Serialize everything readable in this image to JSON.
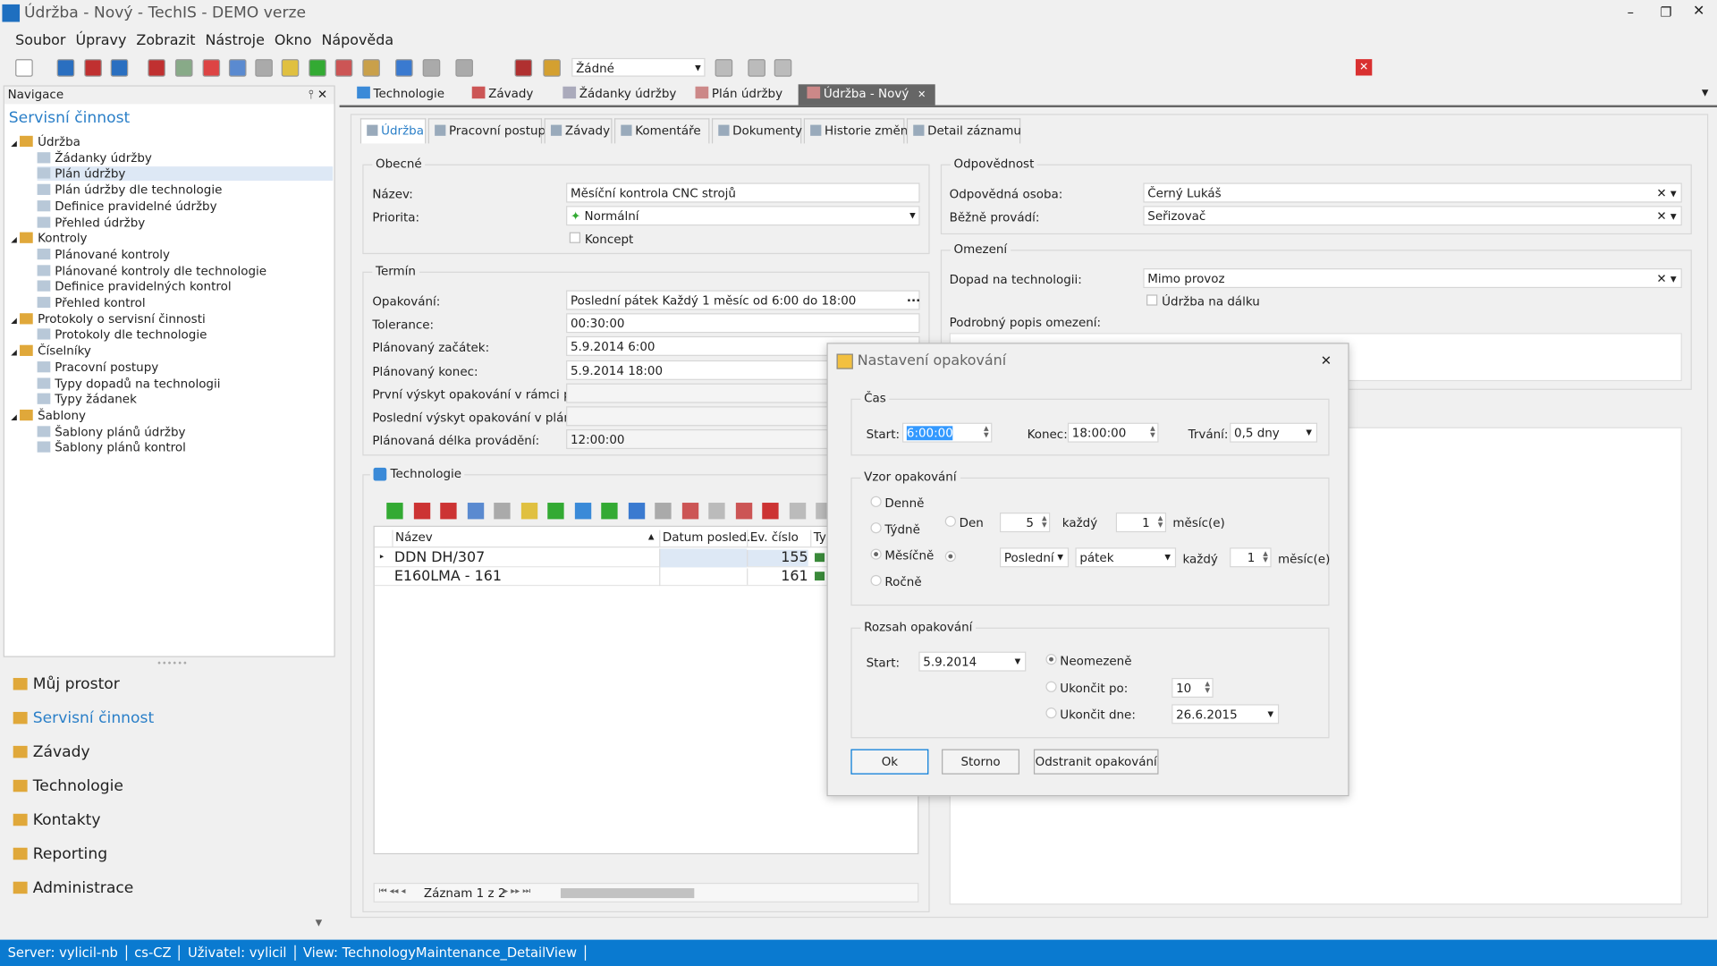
{
  "window": {
    "title": "Údržba - Nový - TechIS - DEMO verze"
  },
  "menu": [
    "Soubor",
    "Úpravy",
    "Zobrazit",
    "Nástroje",
    "Okno",
    "Nápověda"
  ],
  "toolbar": {
    "filter_value": "Žádné"
  },
  "navigation": {
    "title": "Navigace",
    "section": "Servisní činnost",
    "tree": [
      {
        "label": "Údržba",
        "level": 0
      },
      {
        "label": "Žádanky údržby",
        "level": 1
      },
      {
        "label": "Plán údržby",
        "level": 1,
        "selected": true
      },
      {
        "label": "Plán údržby dle technologie",
        "level": 1
      },
      {
        "label": "Definice pravidelné údržby",
        "level": 1
      },
      {
        "label": "Přehled údržby",
        "level": 1
      },
      {
        "label": "Kontroly",
        "level": 0
      },
      {
        "label": "Plánované kontroly",
        "level": 1
      },
      {
        "label": "Plánované kontroly dle technologie",
        "level": 1
      },
      {
        "label": "Definice pravidelných kontrol",
        "level": 1
      },
      {
        "label": "Přehled kontrol",
        "level": 1
      },
      {
        "label": "Protokoly o servisní činnosti",
        "level": 0
      },
      {
        "label": "Protokoly dle technologie",
        "level": 1
      },
      {
        "label": "Číselníky",
        "level": 0
      },
      {
        "label": "Pracovní postupy",
        "level": 1
      },
      {
        "label": "Typy dopadů na technologii",
        "level": 1
      },
      {
        "label": "Typy žádanek",
        "level": 1
      },
      {
        "label": "Šablony",
        "level": 0
      },
      {
        "label": "Šablony plánů údržby",
        "level": 1
      },
      {
        "label": "Šablony plánů kontrol",
        "level": 1
      }
    ],
    "modules": [
      "Můj prostor",
      "Servisní činnost",
      "Závady",
      "Technologie",
      "Kontakty",
      "Reporting",
      "Administrace"
    ]
  },
  "doc_tabs": [
    "Technologie",
    "Závady",
    "Žádanky údržby",
    "Plán údržby",
    "Údržba - Nový"
  ],
  "detail_tabs": [
    "Údržba",
    "Pracovní postup",
    "Závady",
    "Komentáře",
    "Dokumenty",
    "Historie změn",
    "Detail záznamu"
  ],
  "obecne": {
    "title": "Obecné",
    "name_label": "Název:",
    "name": "Měsíční kontrola CNC strojů",
    "priority_label": "Priorita:",
    "priority": "Normální",
    "koncept": "Koncept"
  },
  "termin": {
    "title": "Termín",
    "fields": [
      {
        "label": "Opakování:",
        "value": "Poslední pátek Každý 1 měsíc od 6:00 do 18:00"
      },
      {
        "label": "Tolerance:",
        "value": "00:30:00"
      },
      {
        "label": "Plánovaný začátek:",
        "value": "5.9.2014 6:00"
      },
      {
        "label": "Plánovaný konec:",
        "value": "5.9.2014 18:00"
      },
      {
        "label": "První výskyt opakování v rámci plánu:",
        "value": ""
      },
      {
        "label": "Poslední výskyt opakování v plánu:",
        "value": ""
      },
      {
        "label": "Plánovaná délka provádění:",
        "value": "12:00:00"
      }
    ]
  },
  "technologie": {
    "title": "Technologie",
    "columns": [
      "Název",
      "Datum posled...",
      "Ev. číslo",
      "Typ"
    ],
    "rows": [
      {
        "name": "DDN  DH/307",
        "date": "",
        "ev": "155"
      },
      {
        "name": "E160LMA - 161",
        "date": "",
        "ev": "161"
      }
    ],
    "pager": "Záznam 1 z 2"
  },
  "odpovednost": {
    "title": "Odpovědnost",
    "person_label": "Odpovědná osoba:",
    "person": "Černý Lukáš",
    "performer_label": "Běžně provádí:",
    "performer": "Seřizovač"
  },
  "omezeni": {
    "title": "Omezení",
    "impact_label": "Dopad na technologii:",
    "impact": "Mimo provoz",
    "remote": "Údržba na dálku",
    "desc_label": "Podrobný popis omezení:"
  },
  "dialog": {
    "title": "Nastavení opakování",
    "cas": {
      "title": "Čas",
      "start_label": "Start:",
      "start": "6:00:00",
      "end_label": "Konec:",
      "end": "18:00:00",
      "duration_label": "Trvání:",
      "duration": "0,5 dny"
    },
    "vzor": {
      "title": "Vzor opakování",
      "options": [
        "Denně",
        "Týdně",
        "Měsíčně",
        "Ročně"
      ],
      "selected": "Měsíčně",
      "den_label": "Den",
      "den": "5",
      "kazdy": "každý",
      "every1": "1",
      "mesic": "měsíc(e)",
      "which": "Poslední",
      "weekday": "pátek",
      "every2": "1"
    },
    "rozsah": {
      "title": "Rozsah opakování",
      "start_label": "Start:",
      "start": "5.9.2014",
      "unlimited": "Neomezeně",
      "after_label": "Ukončit po:",
      "after": "10",
      "by_label": "Ukončit dne:",
      "by": "26.6.2015",
      "selected": "Neomezeně"
    },
    "ok": "Ok",
    "cancel": "Storno",
    "remove": "Odstranit opakování"
  },
  "status": [
    "Server: vylicil-nb",
    "cs-CZ",
    "Uživatel: vylicil",
    "View: TechnologyMaintenance_DetailView"
  ],
  "colors": {
    "accent": "#0078d7",
    "link": "#2a7fc8",
    "status_bar": "#0a7ad0",
    "selection": "#dde8f5"
  }
}
